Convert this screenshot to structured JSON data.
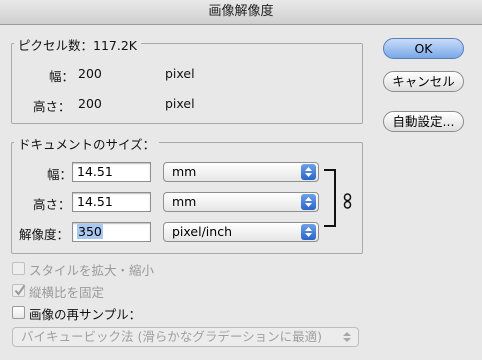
{
  "window": {
    "title": "画像解像度"
  },
  "pixel_dimensions": {
    "legend": "ピクセル数：117.2K",
    "width_label": "幅：",
    "width_value": "200",
    "width_unit": "pixel",
    "height_label": "高さ：",
    "height_value": "200",
    "height_unit": "pixel"
  },
  "document_size": {
    "legend": "ドキュメントのサイズ：",
    "width_label": "幅：",
    "width_value": "14.51",
    "width_unit": "mm",
    "height_label": "高さ：",
    "height_value": "14.51",
    "height_unit": "mm",
    "resolution_label": "解像度：",
    "resolution_value": "350",
    "resolution_unit": "pixel/inch",
    "link_icon": "chain-link-icon"
  },
  "options": {
    "scale_styles": "スタイルを拡大・縮小",
    "constrain_proportions": "縦横比を固定",
    "resample_image": "画像の再サンプル：",
    "resample_method": "バイキュービック法 (滑らかなグラデーションに最適)"
  },
  "buttons": {
    "ok": "OK",
    "cancel": "キャンセル",
    "auto": "自動設定..."
  },
  "colors": {
    "accent": "#2a64c9",
    "selection": "#a9c9f1"
  }
}
